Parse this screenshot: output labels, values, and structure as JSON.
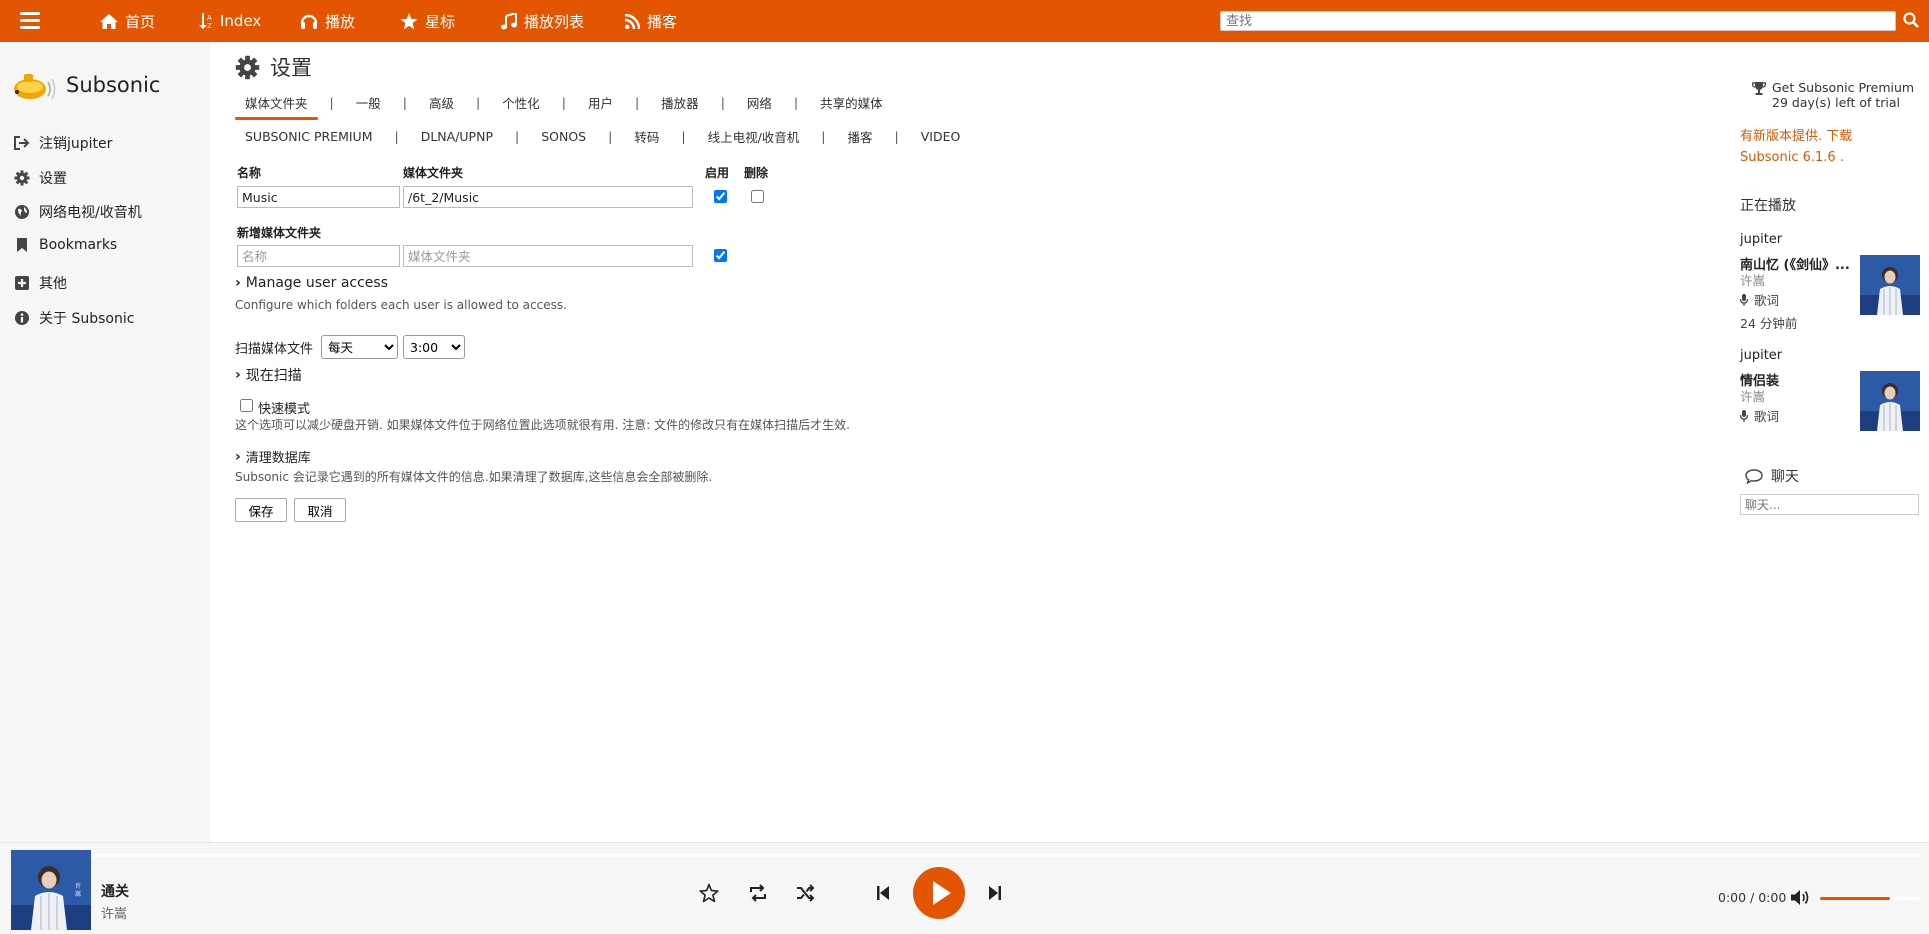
{
  "topnav": {
    "items": [
      {
        "label": "首页",
        "icon": "home-icon"
      },
      {
        "label": "Index",
        "icon": "index-sort-icon"
      },
      {
        "label": "播放",
        "icon": "headphones-icon"
      },
      {
        "label": "星标",
        "icon": "star-icon"
      },
      {
        "label": "播放列表",
        "icon": "music-note-icon"
      },
      {
        "label": "播客",
        "icon": "rss-icon"
      }
    ],
    "search_placeholder": "查找"
  },
  "sidebar": {
    "brand": "Subsonic",
    "items": [
      {
        "label": "注销jupiter",
        "icon": "sign-out-icon"
      },
      {
        "label": "设置",
        "icon": "gear-icon"
      },
      {
        "label": "网络电视/收音机",
        "icon": "globe-icon"
      },
      {
        "label": "Bookmarks",
        "icon": "bookmark-icon"
      },
      {
        "label": "其他",
        "icon": "plus-square-icon"
      },
      {
        "label": "关于 Subsonic",
        "icon": "info-circle-icon"
      }
    ]
  },
  "main": {
    "title": "设置",
    "tabs_row1": [
      "媒体文件夹",
      "一般",
      "高级",
      "个性化",
      "用户",
      "播放器",
      "网络",
      "共享的媒体"
    ],
    "tabs_row2": [
      "SUBSONIC PREMIUM",
      "DLNA/UPNP",
      "SONOS",
      "转码",
      "线上电视/收音机",
      "播客",
      "VIDEO"
    ],
    "active_tab": "媒体文件夹",
    "col_name": "名称",
    "col_folder": "媒体文件夹",
    "col_enabled": "启用",
    "col_delete": "删除",
    "folder_name_value": "Music",
    "folder_path_value": "/6t_2/Music",
    "folder_enabled": true,
    "folder_delete": false,
    "new_folder_label": "新增媒体文件夹",
    "new_name_placeholder": "名称",
    "new_path_placeholder": "媒体文件夹",
    "new_enabled": true,
    "manage_access_label": "Manage user access",
    "manage_access_hint": "Configure which folders each user is allowed to access.",
    "scan_label": "扫描媒体文件",
    "scan_interval": "每天",
    "scan_time": "3:00",
    "scan_now_label": "现在扫描",
    "fast_mode_label": "快速模式",
    "fast_mode_checked": false,
    "fast_mode_hint": "这个选项可以减少硬盘开销. 如果媒体文件位于网络位置此选项就很有用. 注意: 文件的修改只有在媒体扫描后才生效.",
    "clean_db_label": "清理数据库",
    "clean_db_hint": "Subsonic 会记录它遇到的所有媒体文件的信息.如果清理了数据库,这些信息会全部被删除.",
    "save_label": "保存",
    "cancel_label": "取消"
  },
  "right": {
    "premium_line1": "Get Subsonic Premium",
    "premium_line2": "29 day(s) left of trial",
    "new_version_line1": "有新版本提供. 下载",
    "new_version_line2": "Subsonic 6.1.6 .",
    "now_playing_title": "正在播放",
    "entries": [
      {
        "user": "jupiter",
        "song": "南山忆 (《剑仙》...",
        "artist": "许嵩",
        "lyrics": "歌词",
        "ago": "24 分钟前"
      },
      {
        "user": "jupiter",
        "song": "情侣装",
        "artist": "许嵩",
        "lyrics": "歌词",
        "ago": ""
      }
    ],
    "chat_title": "聊天",
    "chat_placeholder": "聊天..."
  },
  "player": {
    "song": "通关",
    "artist": "许嵩",
    "time": "0:00 / 0:00",
    "progress": 0,
    "volume": 0.7
  },
  "colors": {
    "accent": "#e35500",
    "sidebar_bg": "#f6f6f6"
  }
}
